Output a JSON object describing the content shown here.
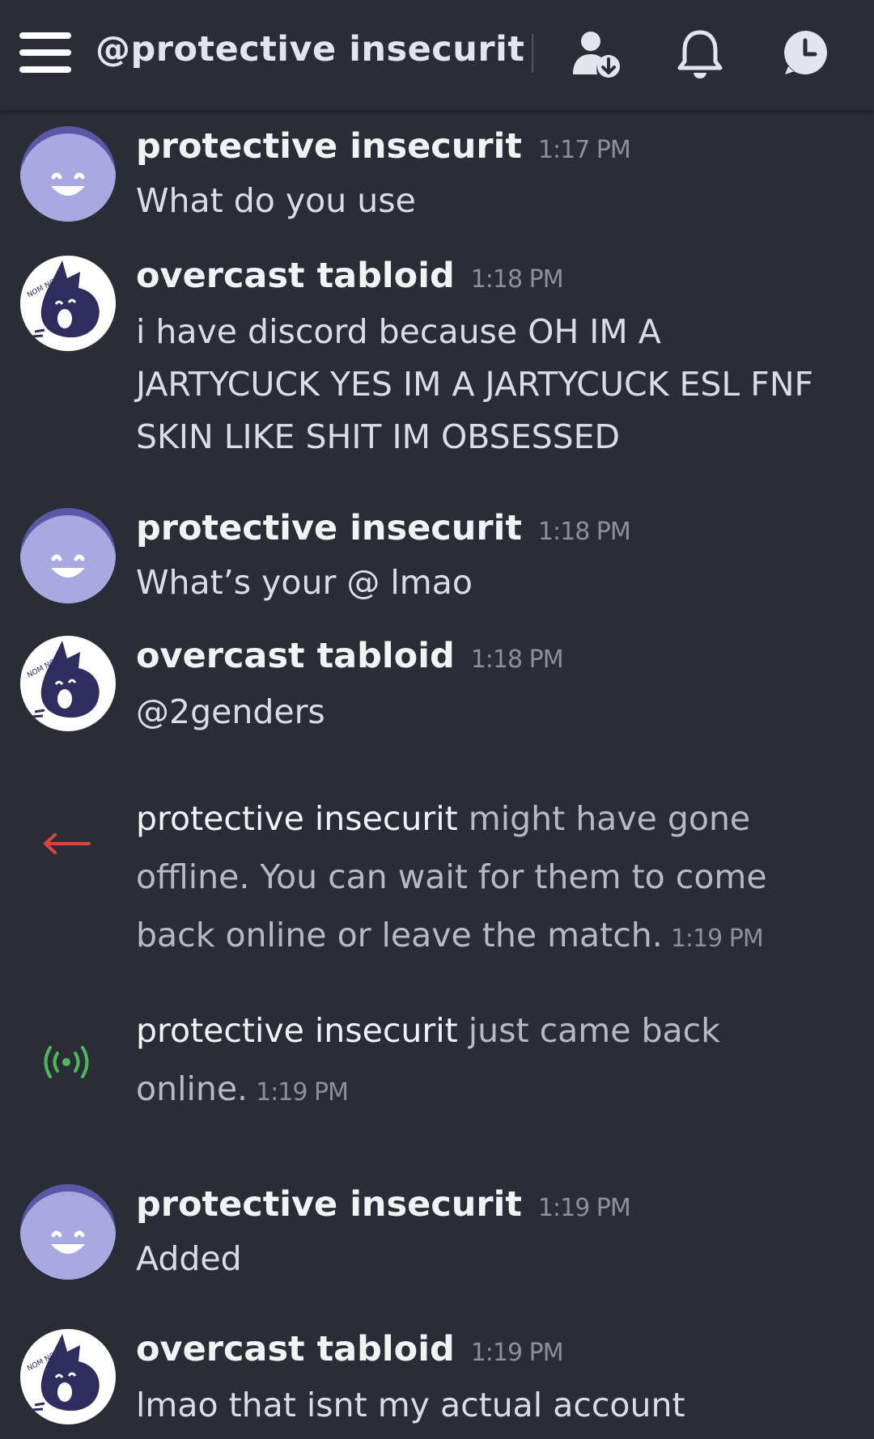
{
  "header": {
    "title": "@protective insecurit",
    "icons": [
      "menu-icon",
      "user-download-icon",
      "bell-icon",
      "clock-icon"
    ]
  },
  "colors": {
    "background": "#2b2d36",
    "avatar_purple": "#a8a9e0",
    "offline_arrow": "#d9473c",
    "online_signal": "#4fb85a"
  },
  "messages": [
    {
      "user": "protective insecurit",
      "time": "1:17 PM",
      "text": "What do you use",
      "avatar": "smiley"
    },
    {
      "user": "overcast tabloid",
      "time": "1:18 PM",
      "text": "i have discord because OH IM A JARTYCUCK YES IM A JARTYCUCK ESL FNF SKIN LIKE SHIT IM OBSESSED",
      "avatar": "nom"
    },
    {
      "user": "protective insecurit",
      "time": "1:18 PM",
      "text": "What’s your @ lmao",
      "avatar": "smiley"
    },
    {
      "user": "overcast tabloid",
      "time": "1:18 PM",
      "text": "@2genders",
      "avatar": "nom"
    },
    {
      "user": "protective insecurit",
      "time": "1:19 PM",
      "text": "Added",
      "avatar": "smiley"
    },
    {
      "user": "overcast tabloid",
      "time": "1:19 PM",
      "text": "lmao that isnt my actual account",
      "avatar": "nom"
    }
  ],
  "system_messages": [
    {
      "name": "protective insecurit",
      "text": " might have gone offline. You can wait for them to come back online or leave the match.",
      "time": "1:19 PM",
      "icon": "arrow-left-icon"
    },
    {
      "name": "protective insecurit",
      "text": " just came back online.",
      "time": "1:19 PM",
      "icon": "signal-icon"
    }
  ],
  "avatar_text": {
    "nom": "NOM NOM"
  }
}
